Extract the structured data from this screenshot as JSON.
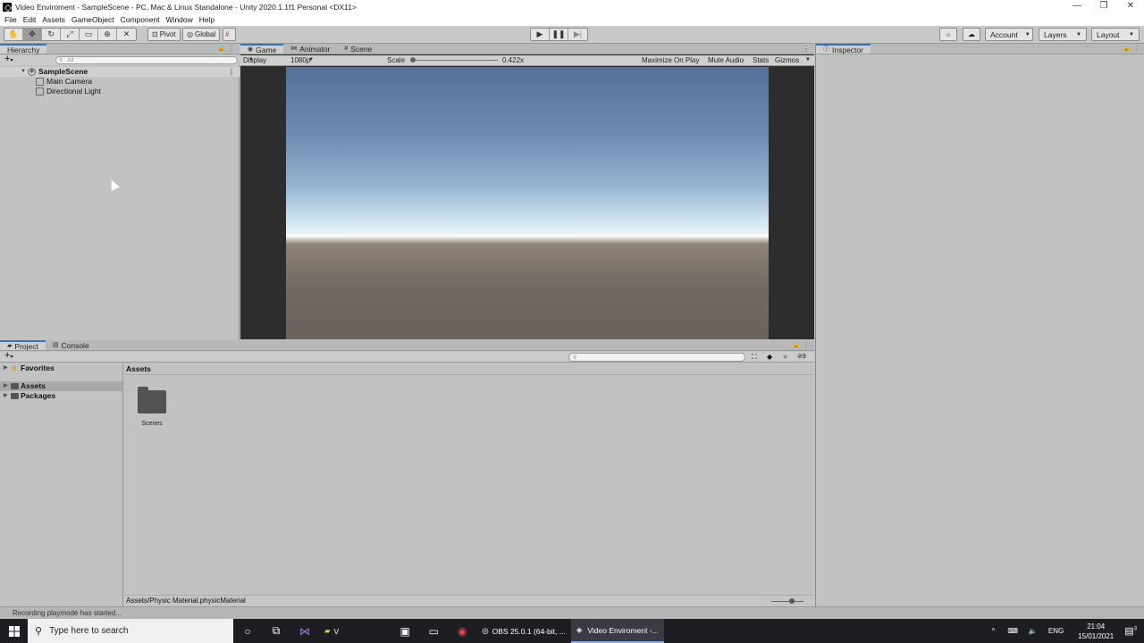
{
  "window": {
    "title": "Video Enviroment - SampleScene - PC, Mac & Linux Standalone - Unity 2020.1.1f1 Personal <DX11>",
    "controls": [
      "—",
      "❐",
      "✕"
    ]
  },
  "menu": [
    "File",
    "Edit",
    "Assets",
    "GameObject",
    "Component",
    "Window",
    "Help"
  ],
  "toolbar": {
    "transform_tools": [
      "hand-icon",
      "move-icon",
      "rotate-icon",
      "scale-icon",
      "rect-icon",
      "transform-icon",
      "custom-tool-icon"
    ],
    "pivot_label": "Pivot",
    "global_label": "Global",
    "play_controls": [
      "play-icon",
      "pause-icon",
      "step-icon"
    ],
    "account_label": "Account",
    "layers_label": "Layers",
    "layout_label": "Layout"
  },
  "hierarchy": {
    "tab_label": "Hierarchy",
    "search_placeholder": "All",
    "scene": "SampleScene",
    "objects": [
      "Main Camera",
      "Directional Light"
    ]
  },
  "game": {
    "tabs": [
      "Game",
      "Animator",
      "Scene"
    ],
    "display": "Display 1",
    "resolution": "1080p (1920x1080)",
    "scale_label": "Scale",
    "scale_value": "0.422x",
    "maximize": "Maximize On Play",
    "mute": "Mute Audio",
    "stats": "Stats",
    "gizmos": "Gizmos"
  },
  "inspector": {
    "tab_label": "Inspector"
  },
  "project": {
    "tabs": [
      "Project",
      "Console"
    ],
    "tree": {
      "favorites": "Favorites",
      "assets": "Assets",
      "packages": "Packages"
    },
    "breadcrumb": "Assets",
    "folder": "Scenes",
    "selected_path": "Assets/Physic Material.physicMaterial",
    "hidden_count": "9"
  },
  "status": "Recording playmode has started...",
  "taskbar": {
    "search_placeholder": "Type here to search",
    "apps": [
      "V",
      "OBS 25.0.1 (64-bit, ...",
      "Video Enviroment -..."
    ],
    "lang": "ENG",
    "time": "21:04",
    "date": "15/01/2021",
    "notifications": "3"
  }
}
